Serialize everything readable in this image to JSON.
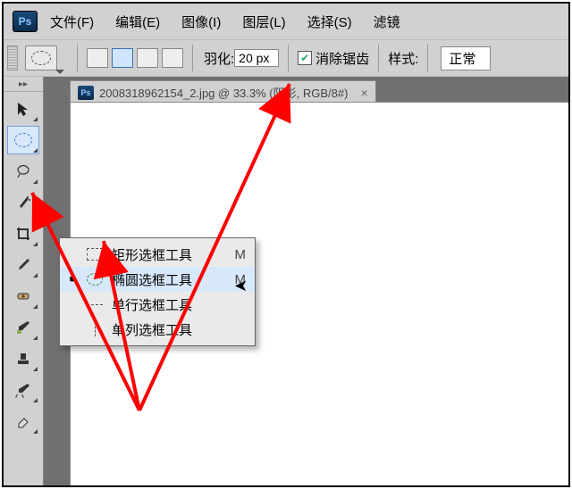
{
  "menu": {
    "items": [
      "文件(F)",
      "编辑(E)",
      "图像(I)",
      "图层(L)",
      "选择(S)",
      "滤镜"
    ]
  },
  "options": {
    "feather_label": "羽化:",
    "feather_value": "20 px",
    "antialias_label": "消除锯齿",
    "style_label": "样式:",
    "style_value": "正常"
  },
  "document": {
    "title": "2008318962154_2.jpg @ 33.3% (阴影, RGB/8#)"
  },
  "flyout": {
    "items": [
      {
        "label": "矩形选框工具",
        "key": "M",
        "mark": "",
        "shape": "rect"
      },
      {
        "label": "椭圆选框工具",
        "key": "M",
        "mark": "■",
        "shape": "ellipse",
        "hover": true
      },
      {
        "label": "单行选框工具",
        "key": "",
        "mark": "",
        "shape": "row"
      },
      {
        "label": "单列选框工具",
        "key": "",
        "mark": "",
        "shape": "col"
      }
    ]
  },
  "tools": {
    "names": [
      "move",
      "marquee",
      "lasso",
      "wand",
      "crop",
      "eyedropper",
      "heal",
      "brush",
      "stamp",
      "history",
      "eraser"
    ]
  }
}
